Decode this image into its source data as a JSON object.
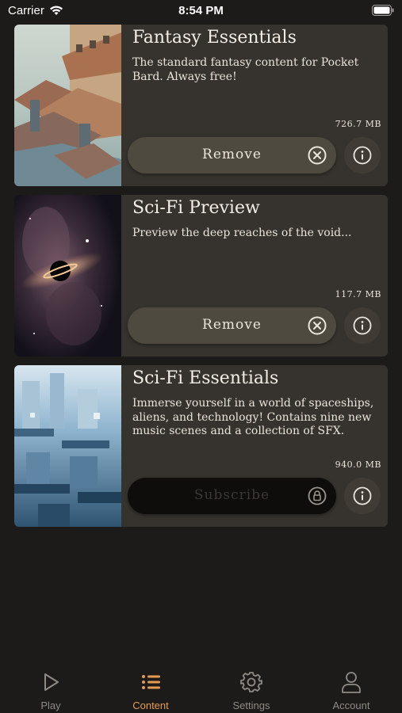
{
  "status_bar": {
    "carrier": "Carrier",
    "time": "8:54 PM"
  },
  "colors": {
    "background": "#1c1b19",
    "card": "#36332e",
    "button": "#4f4a40",
    "accent_active_tab": "#e39b52",
    "inactive_tab": "#8e8a84"
  },
  "content_packs": [
    {
      "title": "Fantasy Essentials",
      "description": "The standard fantasy content for Pocket Bard. Always free!",
      "size": "726.7 MB",
      "action_label": "Remove",
      "action_icon": "circle-x-icon",
      "info_icon": "info-icon"
    },
    {
      "title": "Sci-Fi Preview",
      "description": "Preview the deep reaches of the void...",
      "size": "117.7 MB",
      "action_label": "Remove",
      "action_icon": "circle-x-icon",
      "info_icon": "info-icon"
    },
    {
      "title": "Sci-Fi Essentials",
      "description": "Immerse yourself in a world of spaceships, aliens, and technology! Contains nine new music scenes and a collection of SFX.",
      "size": "940.0 MB",
      "action_label": "Subscribe",
      "action_icon": "lock-icon",
      "info_icon": "info-icon"
    }
  ],
  "tabbar": {
    "tabs": [
      {
        "label": "Play",
        "icon": "play-icon",
        "active": false
      },
      {
        "label": "Content",
        "icon": "list-icon",
        "active": true
      },
      {
        "label": "Settings",
        "icon": "gear-icon",
        "active": false
      },
      {
        "label": "Account",
        "icon": "person-icon",
        "active": false
      }
    ]
  }
}
